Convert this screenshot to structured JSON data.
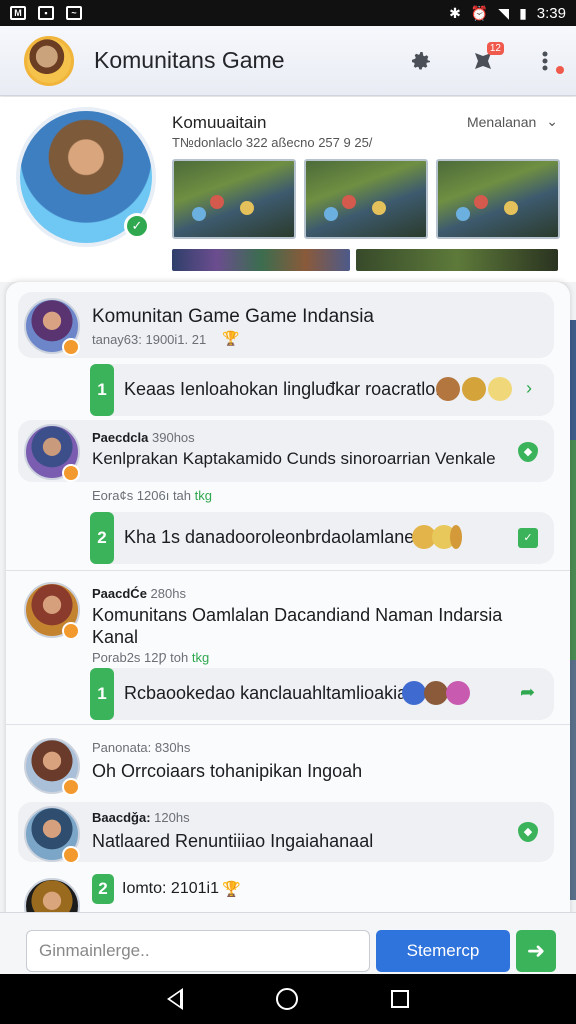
{
  "status_bar": {
    "time": "3:39"
  },
  "app_bar": {
    "title": "Komunitans Game",
    "notification_count": "12"
  },
  "profile": {
    "name": "Komuuaitain",
    "meta": "Т№donlaclo 322 aßecno 257 9 25/",
    "menu_label": "Menalanan"
  },
  "messages": [
    {
      "title": "Komunitan Game Game Indansia",
      "meta": "tanay63: 1900i1. 21",
      "reply": {
        "number": "1",
        "text": "Keaas Ienloahokan lingluđkar roacratlo."
      }
    },
    {
      "author": "Paecdcla",
      "time": "390hos",
      "body": "Kenlprakan Kaptakamido Cunds sinoroarrian Venkale",
      "meta": "Eora¢s 1206ı tah",
      "tag": "tkg",
      "reply": {
        "number": "2",
        "text": "Kha 1s danadooroleonbrdaolamlane"
      }
    },
    {
      "author": "PaacdĆe",
      "time": "280hs",
      "body": "Komunitans Oamlalan Dacandiand Naman Indarsia Kanal",
      "meta": "Porab2s 12Ƿ toh",
      "tag": "tkg",
      "reply": {
        "number": "1",
        "text": "Rcbaookedao kanclauahltamlioakian"
      }
    },
    {
      "author": "Panonata:",
      "time": "830hs",
      "body": "Oh Orrcoiaars tohanipikan Ingoah"
    },
    {
      "author": "Baacdǧa:",
      "time": "120hs",
      "body": "Natlaared Renuntiiiao Ingaiahanaal"
    },
    {
      "number": "2",
      "author": "Iomto:",
      "time": "2101i1"
    }
  ],
  "composer": {
    "placeholder": "Ginmainlerge..",
    "send_label": "Stemercp"
  },
  "colors": {
    "accent_blue": "#2f73dc",
    "accent_green": "#3bb35a",
    "badge_red": "#ef5a4c",
    "badge_orange": "#f39a2e"
  },
  "icons": [
    "gear-icon",
    "notification-icon",
    "more-icon",
    "chevron-down-icon",
    "verified-icon",
    "shield-icon",
    "send-arrow-icon"
  ]
}
